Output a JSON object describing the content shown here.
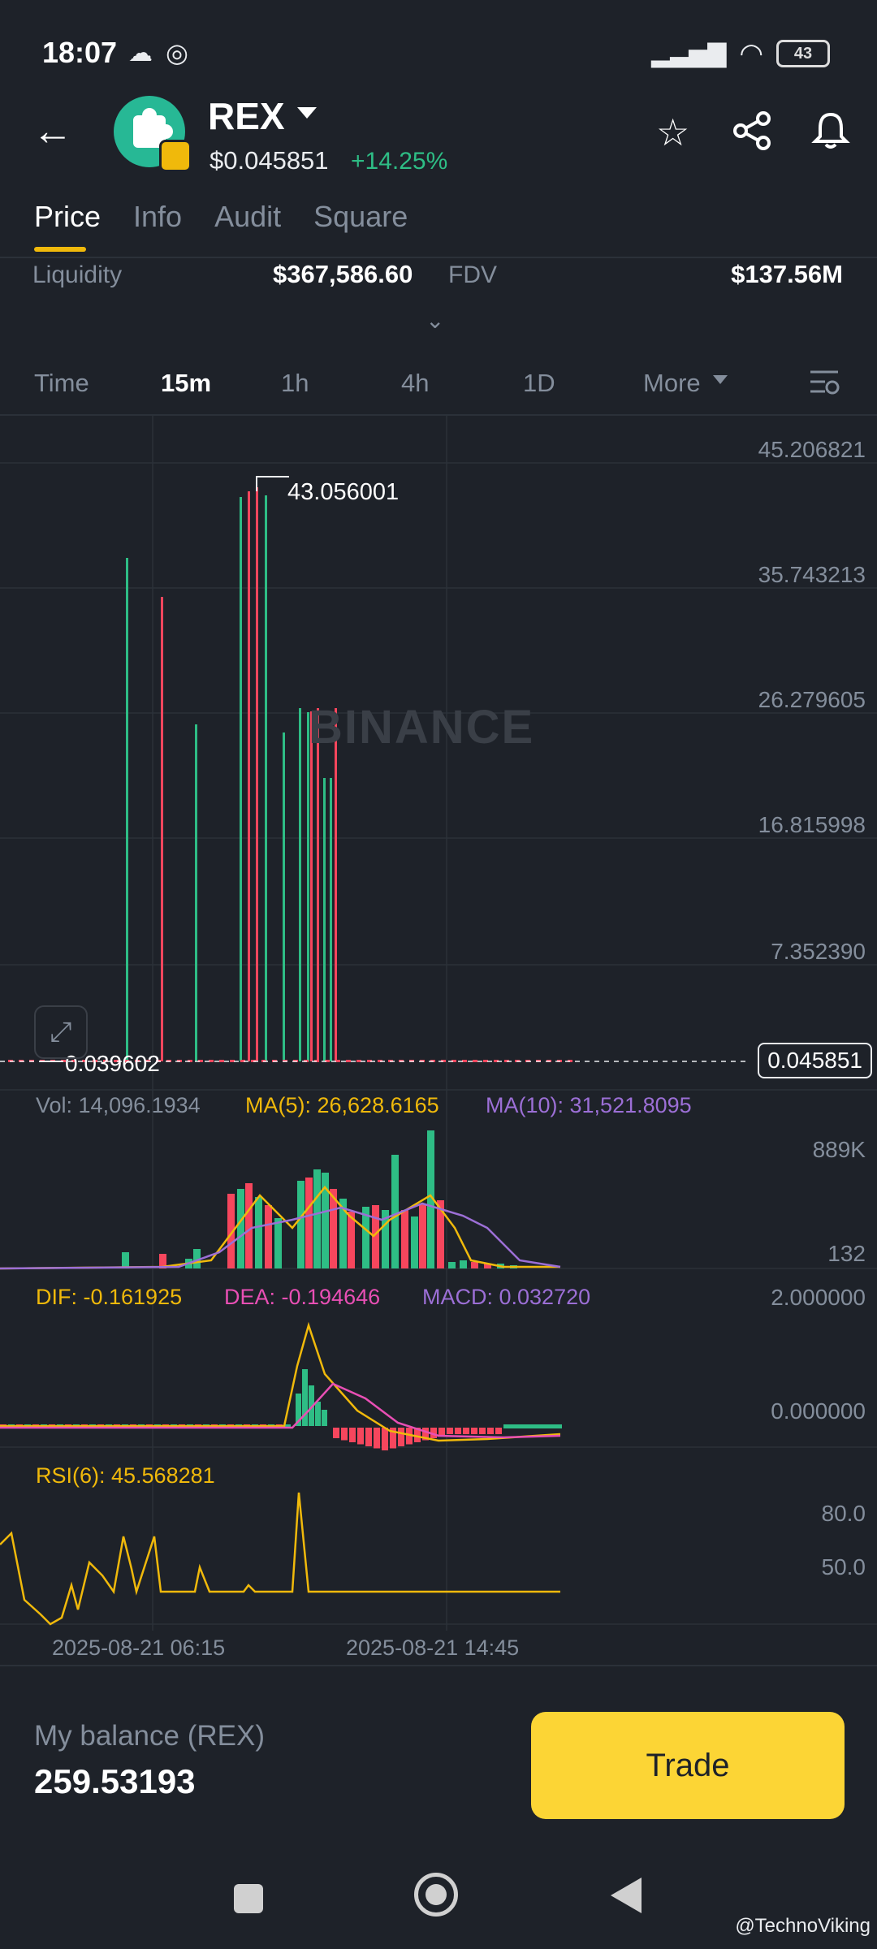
{
  "status_bar": {
    "time": "18:07",
    "battery": "43"
  },
  "header": {
    "token": "REX",
    "price": "$0.045851",
    "change": "+14.25%"
  },
  "tabs": [
    "Price",
    "Info",
    "Audit",
    "Square"
  ],
  "stats": {
    "liquidity_label": "Liquidity",
    "liquidity_value": "$367,586.60",
    "fdv_label": "FDV",
    "fdv_value": "$137.56M"
  },
  "intervals": [
    "Time",
    "15m",
    "1h",
    "4h",
    "1D",
    "More"
  ],
  "chart": {
    "watermark": "BINANCE",
    "price_axis": [
      "45.206821",
      "35.743213",
      "26.279605",
      "16.815998",
      "7.352390"
    ],
    "high_label": "43.056001",
    "low_label": "0.039602",
    "current_price": "0.045851",
    "volume": {
      "vol": "Vol: 14,096.1934",
      "ma5": "MA(5): 26,628.6165",
      "ma10": "MA(10): 31,521.8095",
      "axis_top": "889K",
      "axis_bottom": "132"
    },
    "macd": {
      "dif": "DIF: -0.161925",
      "dea": "DEA: -0.194646",
      "macd": "MACD: 0.032720",
      "axis_top": "2.000000",
      "axis_zero": "0.000000"
    },
    "rsi": {
      "label": "RSI(6): 45.568281",
      "axis_80": "80.0",
      "axis_50": "50.0"
    },
    "dates": [
      "2025-08-21 06:15",
      "2025-08-21 14:45"
    ],
    "colors": {
      "up": "#2ebd85",
      "down": "#f6465d",
      "ma5": "#f0b90b",
      "ma10": "#9c6fd6",
      "dea": "#e84fb4"
    }
  },
  "bottom": {
    "balance_label": "My balance (REX)",
    "balance_value": "259.53193",
    "trade_label": "Trade"
  },
  "credit": "@TechnoViking"
}
